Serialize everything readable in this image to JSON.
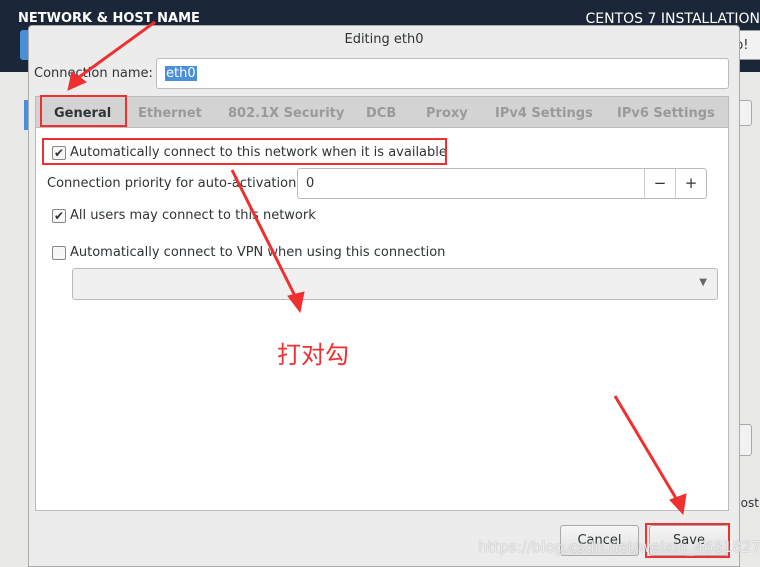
{
  "background": {
    "title": "NETWORK & HOST NAME",
    "installer": "CENTOS 7 INSTALLATION",
    "help_fragment": "p!",
    "hostname_fragment": "host"
  },
  "dialog": {
    "title": "Editing eth0",
    "connection_name_label": "Connection name:",
    "connection_name_value": "eth0",
    "tabs": [
      "General",
      "Ethernet",
      "802.1X Security",
      "DCB",
      "Proxy",
      "IPv4 Settings",
      "IPv6 Settings"
    ],
    "active_tab": "General",
    "general": {
      "auto_connect": {
        "label": "Automatically connect to this network when it is available",
        "checked": true
      },
      "priority_label": "Connection priority for auto-activation:",
      "priority_value": "0",
      "minus": "−",
      "plus": "+",
      "all_users": {
        "label": "All users may connect to this network",
        "checked": true
      },
      "auto_vpn": {
        "label": "Automatically connect to VPN when using this connection",
        "checked": false
      },
      "vpn_select_value": ""
    },
    "cancel_label": "Cancel",
    "save_label": "Save"
  },
  "annotation": {
    "note": "打对勾",
    "color": "#f03030"
  },
  "watermark": "https://blog.csdn.net/weixin_46818279"
}
